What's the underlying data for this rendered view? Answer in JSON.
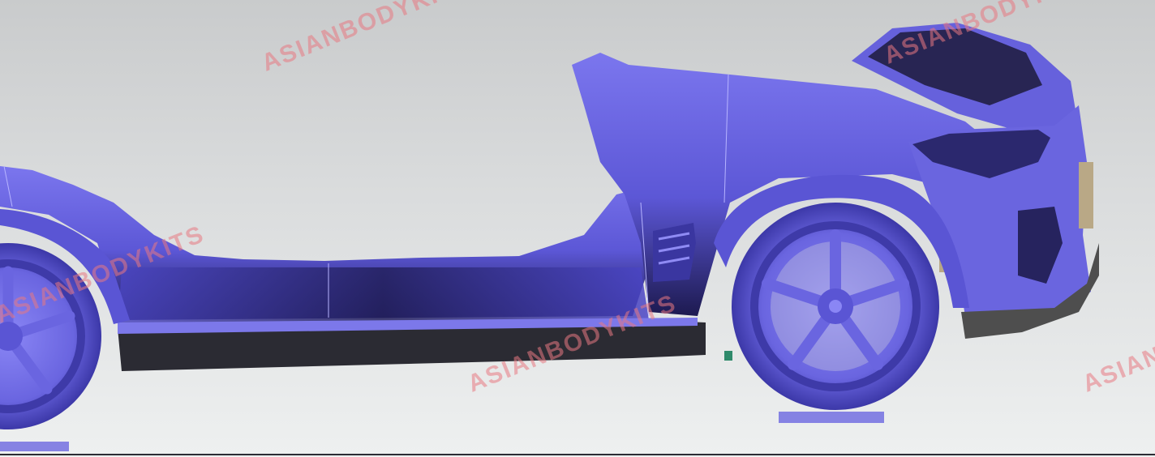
{
  "scene": {
    "description_color": "#6f6ae6",
    "body_color": "#6b66e0",
    "shadow_color": "#201c55",
    "trim_color": "#4a4a4a",
    "background_top": "#c9cbcc",
    "background_bottom": "#eef0f0",
    "watermark_color": "#e87882"
  },
  "watermarks": [
    {
      "text": "ASIANBODYKITS"
    },
    {
      "text": "ASIANBODYKITS"
    },
    {
      "text": "ASIANBODYKITS"
    },
    {
      "text": "ASIANBODYKITS"
    },
    {
      "text": "ASIANBODYKITS"
    }
  ]
}
